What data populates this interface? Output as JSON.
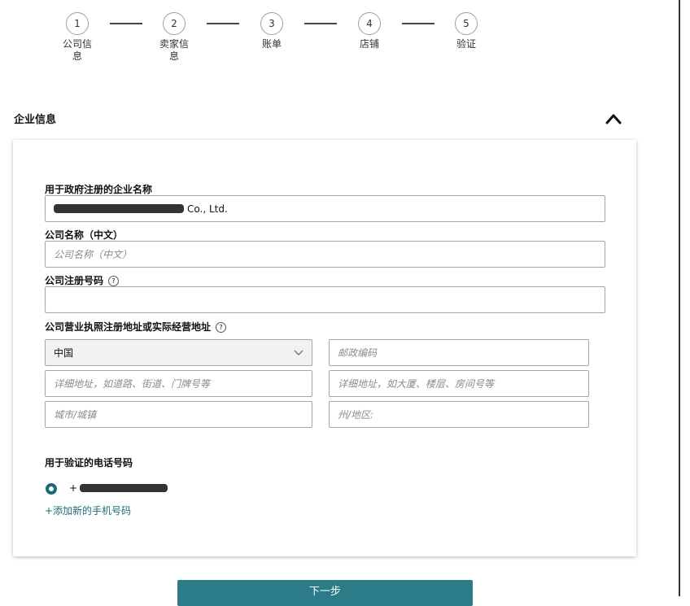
{
  "stepper": {
    "steps": [
      {
        "number": "1",
        "label": "公司信息"
      },
      {
        "number": "2",
        "label": "卖家信息"
      },
      {
        "number": "3",
        "label": "账单"
      },
      {
        "number": "4",
        "label": "店铺"
      },
      {
        "number": "5",
        "label": "验证"
      }
    ]
  },
  "section": {
    "title": "企业信息",
    "collapse_icon": "chevron-up-icon"
  },
  "form": {
    "company_name_label": "用于政府注册的企业名称",
    "company_name_value_suffix": "Co., Ltd.",
    "company_name_cn_label": "公司名称（中文）",
    "company_name_cn_placeholder": "公司名称（中文）",
    "reg_number_label": "公司注册号码",
    "address_label": "公司营业执照注册地址或实际经营地址",
    "country_value": "中国",
    "postal_placeholder": "邮政编码",
    "address1_placeholder": "详细地址，如道路、街道、门牌号等",
    "address2_placeholder": "详细地址，如大厦、楼层、房间号等",
    "city_placeholder": "城市/城镇",
    "state_placeholder": "州/地区:",
    "phone_label": "用于验证的电话号码",
    "phone_prefix": "+",
    "add_phone_link": "+添加新的手机号码"
  },
  "buttons": {
    "next": "下一步"
  },
  "colors": {
    "accent": "#2c7b88",
    "radio": "#1a6b7a"
  }
}
